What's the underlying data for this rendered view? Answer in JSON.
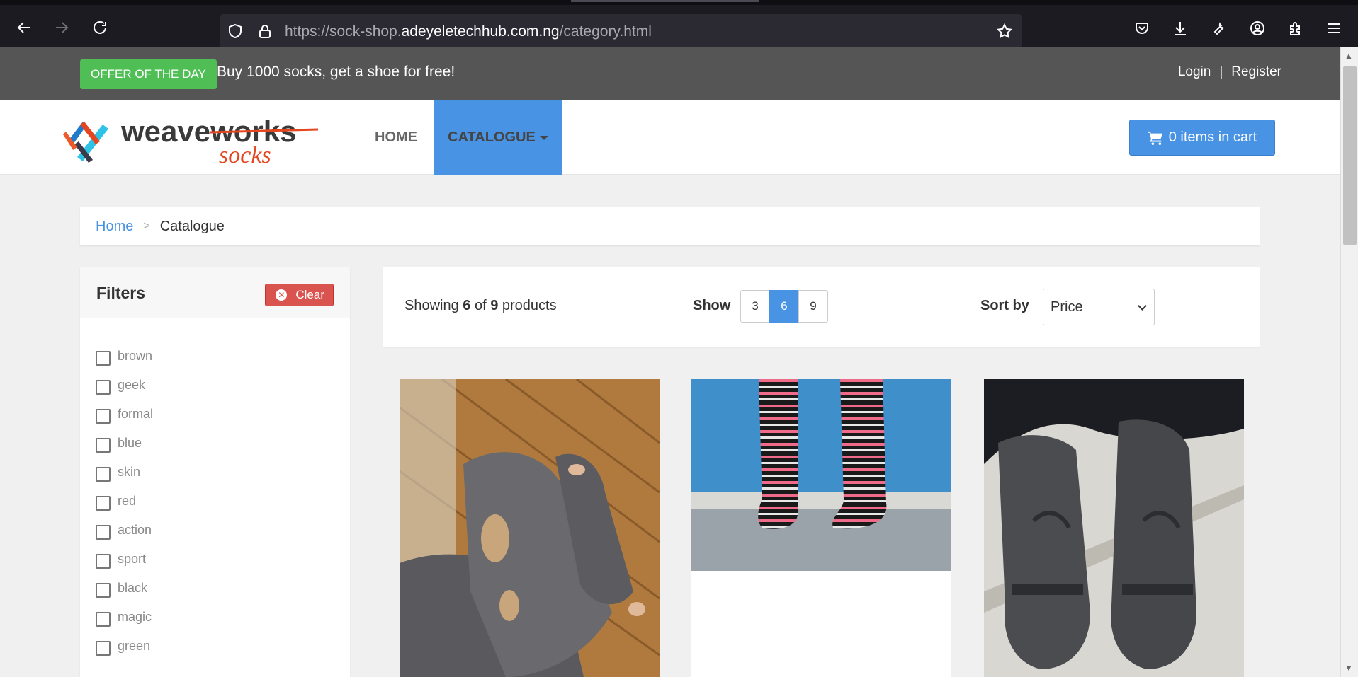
{
  "browser": {
    "url_prefix": "https://sock-shop.",
    "url_host": "adeyeletechhub.com.ng",
    "url_path": "/category.html"
  },
  "topbar": {
    "offer_badge": "OFFER OF THE DAY",
    "offer_text": "Buy 1000 socks, get a shoe for free!",
    "login": "Login",
    "separator": "|",
    "register": "Register"
  },
  "navbar": {
    "logo_text_main": "weaveworks",
    "logo_text_sub": "socks",
    "home": "HOME",
    "catalogue": "CATALOGUE",
    "cart": "0 items in cart"
  },
  "breadcrumb": {
    "home": "Home",
    "arrow": ">",
    "current": "Catalogue"
  },
  "filters": {
    "title": "Filters",
    "clear": "Clear",
    "items": [
      "brown",
      "geek",
      "formal",
      "blue",
      "skin",
      "red",
      "action",
      "sport",
      "black",
      "magic",
      "green"
    ]
  },
  "toolbar": {
    "showing_prefix": "Showing ",
    "showing_count": "6",
    "showing_mid": " of ",
    "showing_total": "9",
    "showing_suffix": " products",
    "show_label": "Show",
    "page_sizes": [
      "3",
      "6",
      "9"
    ],
    "active_page_size": "6",
    "sort_label": "Sort by",
    "sort_value": "Price"
  },
  "colors": {
    "accent": "#4993e4",
    "offer_green": "#4fbf55",
    "clear_red": "#d9534f",
    "topbar_bg": "#555555"
  },
  "products": [
    {
      "image": "holey-grey-socks-on-wooden-deck"
    },
    {
      "image": "striped-black-pink-socks-blue-wall"
    },
    {
      "image": "grey-puma-socks-on-floor"
    }
  ]
}
